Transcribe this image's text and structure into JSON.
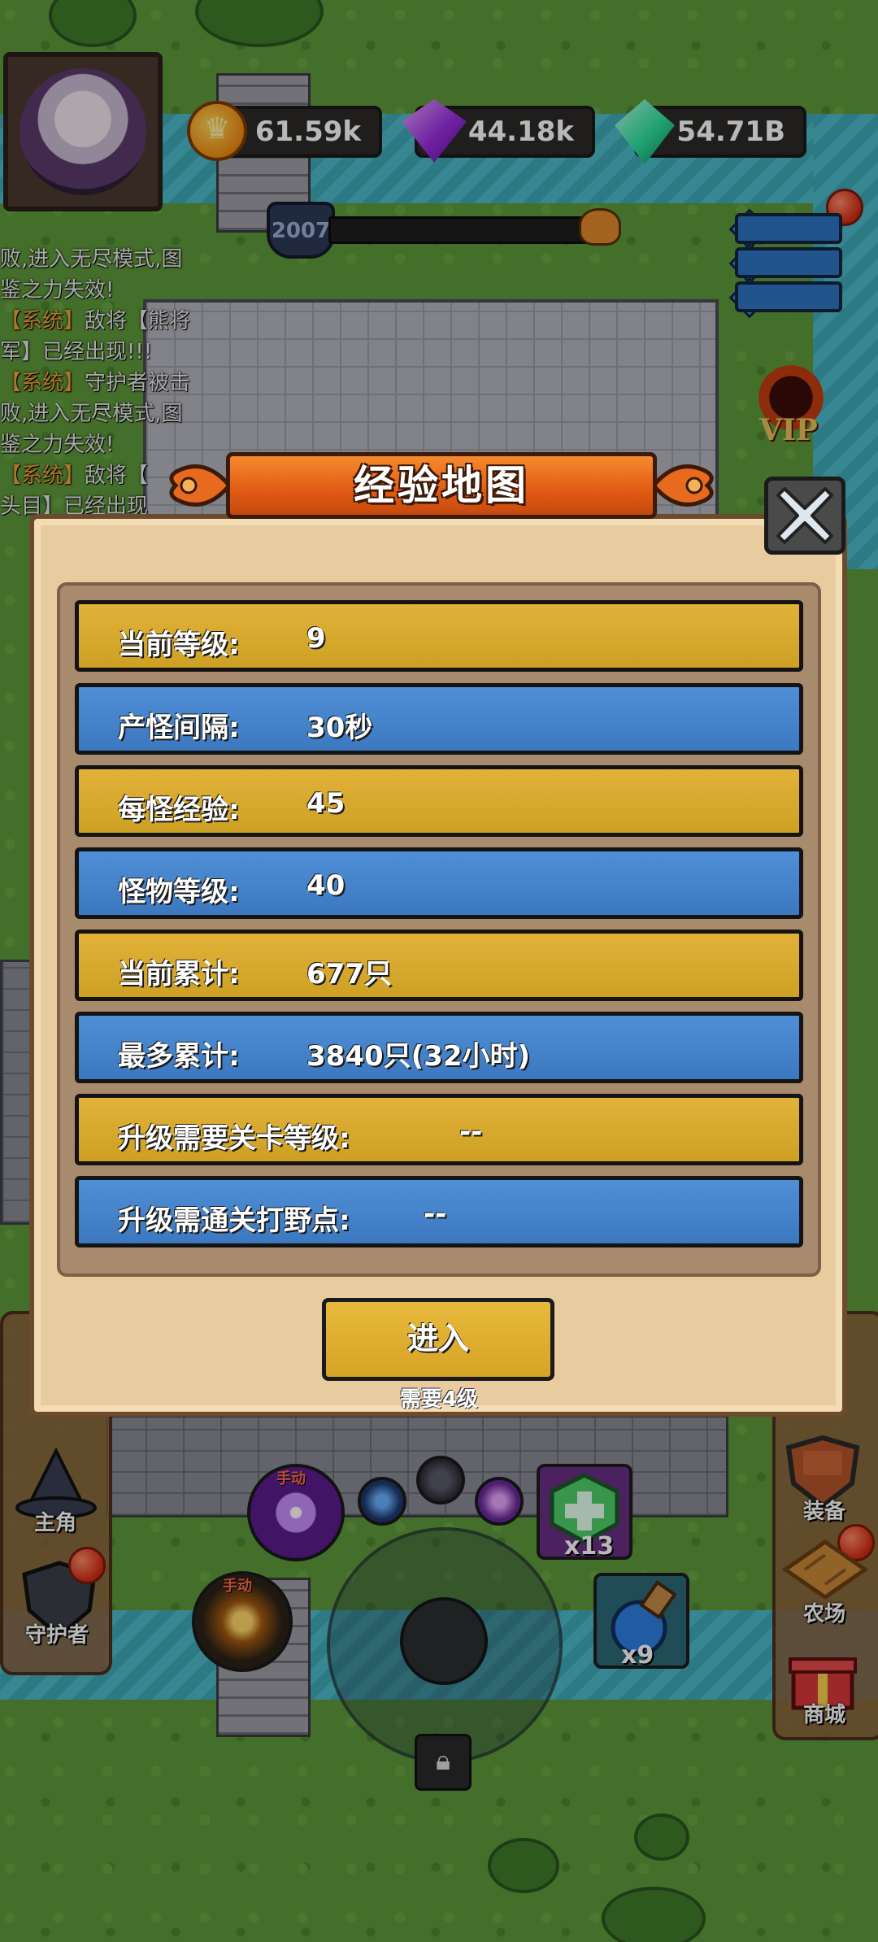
{
  "resources": {
    "gold": "61.59k",
    "purple_gem": "44.18k",
    "green_gem": "54.71B"
  },
  "player": {
    "level": "2007"
  },
  "chat": [
    {
      "type": "text",
      "text": "败,进入无尽模式,图"
    },
    {
      "type": "text",
      "text": "鉴之力失效!"
    },
    {
      "type": "sys",
      "prefix": "【系统】",
      "text": "敌将【熊将"
    },
    {
      "type": "text",
      "text": "军】已经出现!!!"
    },
    {
      "type": "sys",
      "prefix": "【系统】",
      "text": "守护者被击"
    },
    {
      "type": "text",
      "text": "败,进入无尽模式,图"
    },
    {
      "type": "text",
      "text": "鉴之力失效!"
    },
    {
      "type": "sys",
      "prefix": "【系统】",
      "text": "敌将【"
    },
    {
      "type": "text",
      "text": "头目】已经出现"
    }
  ],
  "side_left": {
    "hero": "主角",
    "guardian": "守护者"
  },
  "side_right": {
    "equip": "装备",
    "farm": "农场",
    "shop": "商城"
  },
  "vip": "VIP",
  "skills": {
    "tag": "手动"
  },
  "items": {
    "potion_green_count": "x13",
    "potion_blue_count": "x9"
  },
  "modal": {
    "title": "经验地图",
    "rows": [
      {
        "label": "当前等级:",
        "value": "9"
      },
      {
        "label": "产怪间隔:",
        "value": "30秒"
      },
      {
        "label": "每怪经验:",
        "value": "45"
      },
      {
        "label": "怪物等级:",
        "value": "40"
      },
      {
        "label": "当前累计:",
        "value": "677只"
      },
      {
        "label": "最多累计:",
        "value": "3840只(32小时)"
      },
      {
        "label": "升级需要关卡等级:",
        "value": "--"
      },
      {
        "label": "升级需通关打野点:",
        "value": "--"
      }
    ],
    "enter_label": "进入",
    "requirement": "需要4级"
  },
  "colors": {
    "row_gold": "#cda024",
    "row_blue": "#3c78bf",
    "title_orange": "#e25a14",
    "panel": "#e8cca0"
  }
}
